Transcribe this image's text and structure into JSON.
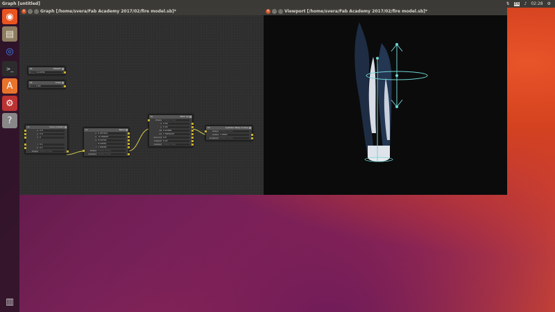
{
  "top_panel": {
    "title": "Graph [untitled]",
    "clock": "02:28",
    "kbd": "EN",
    "tray_icons": [
      "network-icon",
      "keyboard-icon",
      "volume-icon",
      "clock-text",
      "gear-icon"
    ]
  },
  "launcher": {
    "items": [
      {
        "name": "ubuntu-home-icon",
        "glyph": "◉",
        "color": "#e95420"
      },
      {
        "name": "files-icon",
        "glyph": "▤",
        "color": "#9b8a6a"
      },
      {
        "name": "chrome-icon",
        "glyph": "◎",
        "color": "#4285f4"
      },
      {
        "name": "terminal-icon",
        "glyph": ">_",
        "color": "#2c2c2c"
      },
      {
        "name": "software-center-icon",
        "glyph": "A",
        "color": "#e8732c"
      },
      {
        "name": "settings-icon",
        "glyph": "⚙",
        "color": "#c33"
      },
      {
        "name": "help-icon",
        "glyph": "?",
        "color": "#888"
      },
      {
        "name": "trash-icon",
        "glyph": "🗑",
        "color": "#777"
      }
    ]
  },
  "graph_window": {
    "title": "Graph [/home/svera/Fab Academy 2017/02/fire model.sb]*"
  },
  "viewport_window": {
    "title": "Viewport [/home/svera/Fab Academy 2017/02/fire model.sb]*"
  },
  "nodes": [
    {
      "id": "n_height",
      "badge": "h1",
      "title": "HEIGHT",
      "rows": [
        {
          "label": "x",
          "value": "3.14159",
          "dim": false
        }
      ]
    },
    {
      "id": "n_scale",
      "badge": "h1",
      "title": "Scale",
      "rows": [
        {
          "label": "x",
          "value": "0.65",
          "dim": false
        }
      ]
    },
    {
      "id": "n_cone",
      "badge": "c1",
      "title": "Cone (center)",
      "rows": [
        {
          "label": "x",
          "value": "0.0",
          "dim": false
        },
        {
          "label": "y",
          "value": "0.0",
          "dim": false
        },
        {
          "label": "z",
          "value": "0",
          "dim": false
        },
        {
          "label": "",
          "value": "",
          "dim": false
        },
        {
          "label": "r",
          "value": "0.1",
          "dim": false
        },
        {
          "label": "h",
          "value": "0.1",
          "dim": false
        },
        {
          "label": "shape",
          "value": "Shape (tree)",
          "dim": true
        }
      ]
    },
    {
      "id": "n_repel",
      "badge": "r1",
      "title": "Repel",
      "rows": [
        {
          "label": "x",
          "value": "0.047201",
          "dim": false
        },
        {
          "label": "y",
          "value": "-0.190467",
          "dim": false
        },
        {
          "label": "z",
          "value": "0.19793",
          "dim": false
        },
        {
          "label": "",
          "value": "0.10351",
          "dim": false
        },
        {
          "label": "r",
          "value": "1.04436",
          "dim": false
        },
        {
          "label": "shape",
          "value": "Shape (tree)",
          "dim": true
        },
        {
          "label": "repelled",
          "value": "Shape (tree)",
          "dim": true
        }
      ]
    },
    {
      "id": "n_twist",
      "badge": "t1",
      "title": "Twist (4)",
      "rows": [
        {
          "label": "shape",
          "value": "Shape (tree)",
          "dim": true
        },
        {
          "label": "x",
          "value": "0.04",
          "dim": false
        },
        {
          "label": "y",
          "value": "0.04",
          "dim": false
        },
        {
          "label": "z0",
          "value": "0.07890",
          "dim": false
        },
        {
          "label": "z1",
          "value": "1.5834233",
          "dim": false
        },
        {
          "label": "amount",
          "value": "0.8",
          "dim": false
        },
        {
          "label": "shape2",
          "value": "0.22",
          "dim": false
        },
        {
          "label": "twisted",
          "value": "Shape (tree)",
          "dim": true
        }
      ]
    },
    {
      "id": "n_cyl",
      "badge": "c2",
      "title": "Cylinder Wrap (Y-axis)",
      "rows": [
        {
          "label": "shape",
          "value": "Shape (tree)",
          "dim": true
        },
        {
          "label": "radius",
          "value": "1.0900",
          "dim": false
        },
        {
          "label": "wrapped",
          "value": "Shape (tree)",
          "dim": true
        }
      ]
    }
  ]
}
